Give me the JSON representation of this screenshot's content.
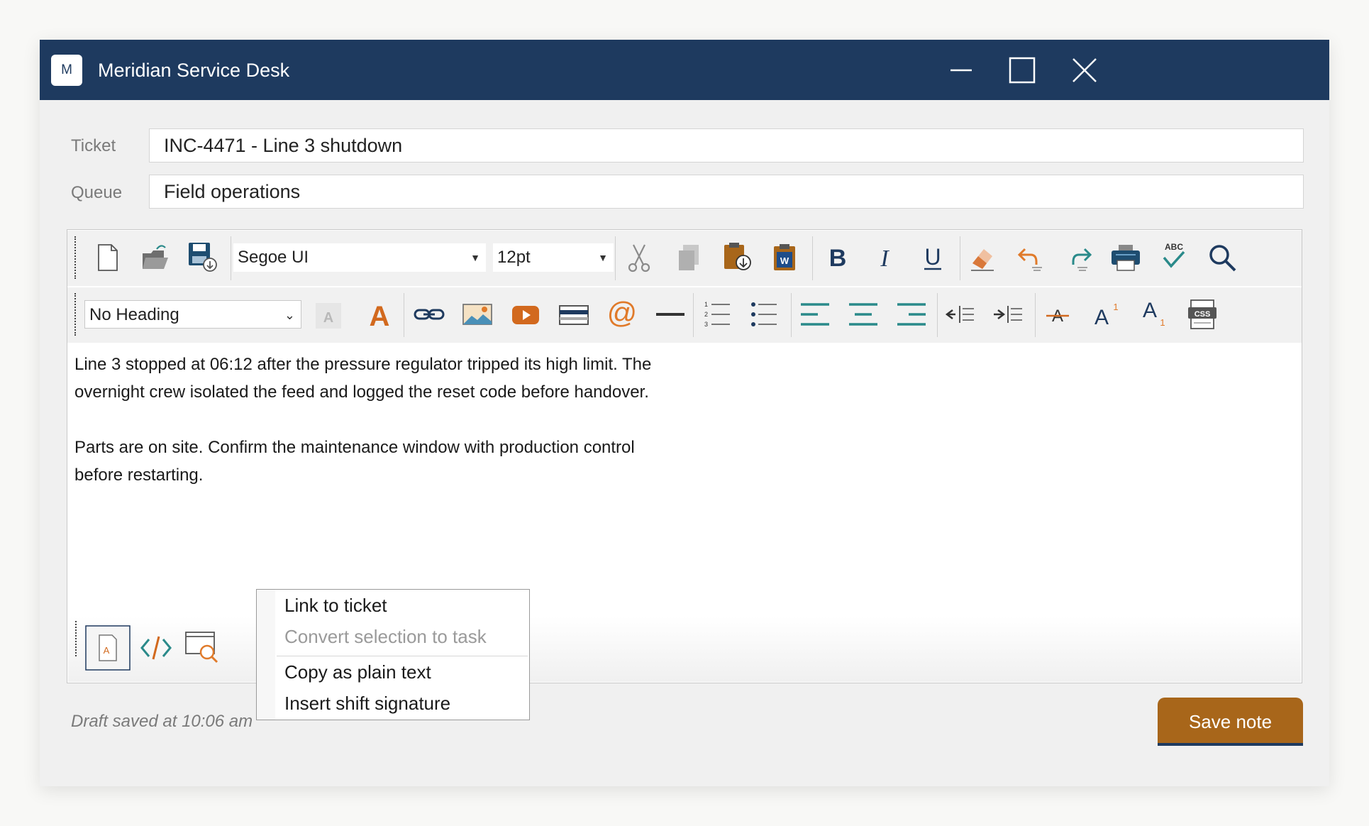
{
  "window": {
    "title": "Meridian Service Desk",
    "icon_letter": "M"
  },
  "form": {
    "ticket_label": "Ticket",
    "ticket_value": "INC-4471 - Line 3 shutdown",
    "queue_label": "Queue",
    "queue_value": "Field operations"
  },
  "toolbar": {
    "font_family": "Segoe UI",
    "font_size": "12pt",
    "heading": "No Heading",
    "icons_row1": [
      "new-document-icon",
      "open-folder-icon",
      "save-icon",
      "cut-icon",
      "copy-icon",
      "paste-icon",
      "paste-from-word-icon",
      "bold-icon",
      "italic-icon",
      "underline-icon",
      "eraser-icon",
      "undo-icon",
      "redo-icon",
      "print-icon",
      "spell-check-icon",
      "find-icon"
    ],
    "icons_row2": [
      "font-color-disabled-icon",
      "font-color-icon",
      "link-icon",
      "image-icon",
      "video-icon",
      "media-icon",
      "at-mention-icon",
      "horizontal-rule-icon",
      "ordered-list-icon",
      "bullet-list-icon",
      "align-left-icon",
      "align-center-icon",
      "align-right-icon",
      "outdent-icon",
      "indent-icon",
      "strikethrough-icon",
      "superscript-icon",
      "subscript-icon",
      "css-icon"
    ],
    "bold_glyph": "B",
    "italic_glyph": "I",
    "underline_glyph": "U",
    "abc_glyph": "ABC",
    "css_glyph": "CSS",
    "word_glyph": "W",
    "font_glyph": "A",
    "sup_glyph": "1",
    "sub_glyph": "1",
    "at_glyph": "@",
    "list_glyph": "1 2 3"
  },
  "editor": {
    "paragraphs": [
      "Line 3 stopped at 06:12 after the pressure regulator tripped its high limit. The",
      "overnight crew isolated the feed and logged the reset code before handover.",
      "",
      "Parts are on site. Confirm the maintenance window with production control",
      "before restarting."
    ]
  },
  "view_modes": [
    "design-view-icon",
    "html-source-icon",
    "preview-icon"
  ],
  "context_menu": {
    "items": [
      {
        "label": "Link to ticket",
        "enabled": true
      },
      {
        "label": "Convert selection to task",
        "enabled": false
      },
      {
        "label": "Copy as plain text",
        "enabled": true
      },
      {
        "label": "Insert shift signature",
        "enabled": true
      }
    ]
  },
  "status": {
    "draft_text": "Draft saved at 10:06 am"
  },
  "actions": {
    "save_label": "Save note"
  },
  "colors": {
    "titlebar": "#1e3a5f",
    "accent": "#a8661a",
    "teal": "#2a8a8a",
    "orange": "#d2691e"
  }
}
